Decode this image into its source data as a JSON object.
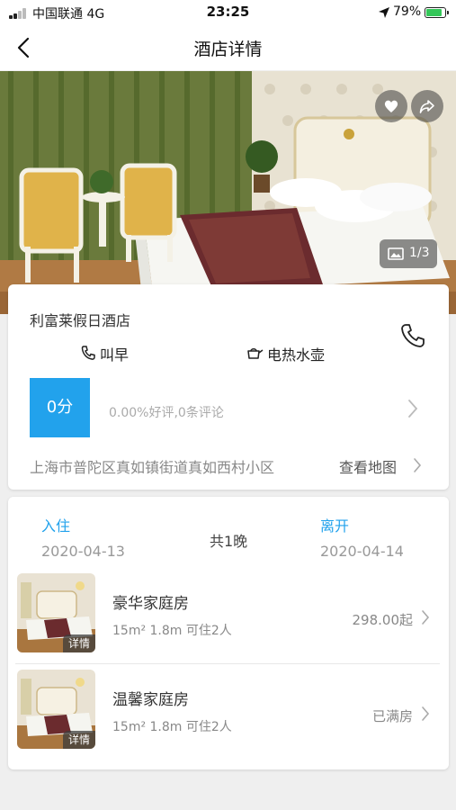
{
  "status_bar": {
    "carrier": "中国联通  4G",
    "time": "23:25",
    "battery": "79%"
  },
  "nav": {
    "title": "酒店详情"
  },
  "hero": {
    "photo_counter": "1/3"
  },
  "hotel": {
    "name": "利富莱假日酒店",
    "amenities": [
      "叫早",
      "电热水壶"
    ],
    "score": "0分",
    "review_summary": "0.00%好评,0条评论",
    "address": "上海市普陀区真如镇街道真如西村小区",
    "map_link": "查看地图"
  },
  "booking": {
    "checkin_label": "入住",
    "checkin_date": "2020-04-13",
    "nights": "共1晚",
    "checkout_label": "离开",
    "checkout_date": "2020-04-14"
  },
  "rooms": [
    {
      "name": "豪华家庭房",
      "specs": "15m² 1.8m 可住2人",
      "price": "298.00起",
      "tag": "详情"
    },
    {
      "name": "温馨家庭房",
      "specs": "15m² 1.8m 可住2人",
      "price": "已满房",
      "tag": "详情"
    }
  ],
  "colors": {
    "accent": "#22a2ec",
    "background": "#efefef"
  },
  "icons": [
    "back-icon",
    "heart-icon",
    "share-icon",
    "image-icon",
    "phone-icon",
    "wake-call-icon",
    "kettle-icon",
    "chevron-right-icon",
    "location-arrow-icon",
    "battery-icon",
    "signal-icon"
  ]
}
